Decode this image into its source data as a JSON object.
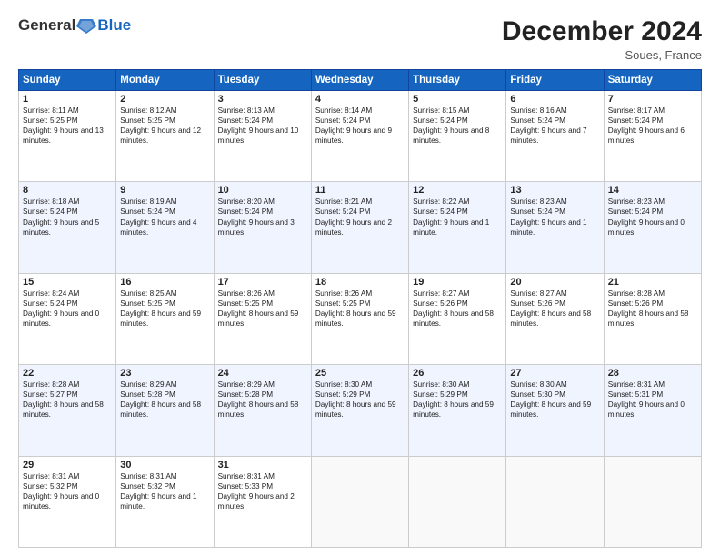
{
  "header": {
    "logo_general": "General",
    "logo_blue": "Blue",
    "month_title": "December 2024",
    "location": "Soues, France"
  },
  "weekdays": [
    "Sunday",
    "Monday",
    "Tuesday",
    "Wednesday",
    "Thursday",
    "Friday",
    "Saturday"
  ],
  "weeks": [
    [
      {
        "day": "1",
        "sunrise": "Sunrise: 8:11 AM",
        "sunset": "Sunset: 5:25 PM",
        "daylight": "Daylight: 9 hours and 13 minutes."
      },
      {
        "day": "2",
        "sunrise": "Sunrise: 8:12 AM",
        "sunset": "Sunset: 5:25 PM",
        "daylight": "Daylight: 9 hours and 12 minutes."
      },
      {
        "day": "3",
        "sunrise": "Sunrise: 8:13 AM",
        "sunset": "Sunset: 5:24 PM",
        "daylight": "Daylight: 9 hours and 10 minutes."
      },
      {
        "day": "4",
        "sunrise": "Sunrise: 8:14 AM",
        "sunset": "Sunset: 5:24 PM",
        "daylight": "Daylight: 9 hours and 9 minutes."
      },
      {
        "day": "5",
        "sunrise": "Sunrise: 8:15 AM",
        "sunset": "Sunset: 5:24 PM",
        "daylight": "Daylight: 9 hours and 8 minutes."
      },
      {
        "day": "6",
        "sunrise": "Sunrise: 8:16 AM",
        "sunset": "Sunset: 5:24 PM",
        "daylight": "Daylight: 9 hours and 7 minutes."
      },
      {
        "day": "7",
        "sunrise": "Sunrise: 8:17 AM",
        "sunset": "Sunset: 5:24 PM",
        "daylight": "Daylight: 9 hours and 6 minutes."
      }
    ],
    [
      {
        "day": "8",
        "sunrise": "Sunrise: 8:18 AM",
        "sunset": "Sunset: 5:24 PM",
        "daylight": "Daylight: 9 hours and 5 minutes."
      },
      {
        "day": "9",
        "sunrise": "Sunrise: 8:19 AM",
        "sunset": "Sunset: 5:24 PM",
        "daylight": "Daylight: 9 hours and 4 minutes."
      },
      {
        "day": "10",
        "sunrise": "Sunrise: 8:20 AM",
        "sunset": "Sunset: 5:24 PM",
        "daylight": "Daylight: 9 hours and 3 minutes."
      },
      {
        "day": "11",
        "sunrise": "Sunrise: 8:21 AM",
        "sunset": "Sunset: 5:24 PM",
        "daylight": "Daylight: 9 hours and 2 minutes."
      },
      {
        "day": "12",
        "sunrise": "Sunrise: 8:22 AM",
        "sunset": "Sunset: 5:24 PM",
        "daylight": "Daylight: 9 hours and 1 minute."
      },
      {
        "day": "13",
        "sunrise": "Sunrise: 8:23 AM",
        "sunset": "Sunset: 5:24 PM",
        "daylight": "Daylight: 9 hours and 1 minute."
      },
      {
        "day": "14",
        "sunrise": "Sunrise: 8:23 AM",
        "sunset": "Sunset: 5:24 PM",
        "daylight": "Daylight: 9 hours and 0 minutes."
      }
    ],
    [
      {
        "day": "15",
        "sunrise": "Sunrise: 8:24 AM",
        "sunset": "Sunset: 5:24 PM",
        "daylight": "Daylight: 9 hours and 0 minutes."
      },
      {
        "day": "16",
        "sunrise": "Sunrise: 8:25 AM",
        "sunset": "Sunset: 5:25 PM",
        "daylight": "Daylight: 8 hours and 59 minutes."
      },
      {
        "day": "17",
        "sunrise": "Sunrise: 8:26 AM",
        "sunset": "Sunset: 5:25 PM",
        "daylight": "Daylight: 8 hours and 59 minutes."
      },
      {
        "day": "18",
        "sunrise": "Sunrise: 8:26 AM",
        "sunset": "Sunset: 5:25 PM",
        "daylight": "Daylight: 8 hours and 59 minutes."
      },
      {
        "day": "19",
        "sunrise": "Sunrise: 8:27 AM",
        "sunset": "Sunset: 5:26 PM",
        "daylight": "Daylight: 8 hours and 58 minutes."
      },
      {
        "day": "20",
        "sunrise": "Sunrise: 8:27 AM",
        "sunset": "Sunset: 5:26 PM",
        "daylight": "Daylight: 8 hours and 58 minutes."
      },
      {
        "day": "21",
        "sunrise": "Sunrise: 8:28 AM",
        "sunset": "Sunset: 5:26 PM",
        "daylight": "Daylight: 8 hours and 58 minutes."
      }
    ],
    [
      {
        "day": "22",
        "sunrise": "Sunrise: 8:28 AM",
        "sunset": "Sunset: 5:27 PM",
        "daylight": "Daylight: 8 hours and 58 minutes."
      },
      {
        "day": "23",
        "sunrise": "Sunrise: 8:29 AM",
        "sunset": "Sunset: 5:28 PM",
        "daylight": "Daylight: 8 hours and 58 minutes."
      },
      {
        "day": "24",
        "sunrise": "Sunrise: 8:29 AM",
        "sunset": "Sunset: 5:28 PM",
        "daylight": "Daylight: 8 hours and 58 minutes."
      },
      {
        "day": "25",
        "sunrise": "Sunrise: 8:30 AM",
        "sunset": "Sunset: 5:29 PM",
        "daylight": "Daylight: 8 hours and 59 minutes."
      },
      {
        "day": "26",
        "sunrise": "Sunrise: 8:30 AM",
        "sunset": "Sunset: 5:29 PM",
        "daylight": "Daylight: 8 hours and 59 minutes."
      },
      {
        "day": "27",
        "sunrise": "Sunrise: 8:30 AM",
        "sunset": "Sunset: 5:30 PM",
        "daylight": "Daylight: 8 hours and 59 minutes."
      },
      {
        "day": "28",
        "sunrise": "Sunrise: 8:31 AM",
        "sunset": "Sunset: 5:31 PM",
        "daylight": "Daylight: 9 hours and 0 minutes."
      }
    ],
    [
      {
        "day": "29",
        "sunrise": "Sunrise: 8:31 AM",
        "sunset": "Sunset: 5:32 PM",
        "daylight": "Daylight: 9 hours and 0 minutes."
      },
      {
        "day": "30",
        "sunrise": "Sunrise: 8:31 AM",
        "sunset": "Sunset: 5:32 PM",
        "daylight": "Daylight: 9 hours and 1 minute."
      },
      {
        "day": "31",
        "sunrise": "Sunrise: 8:31 AM",
        "sunset": "Sunset: 5:33 PM",
        "daylight": "Daylight: 9 hours and 2 minutes."
      },
      null,
      null,
      null,
      null
    ]
  ]
}
